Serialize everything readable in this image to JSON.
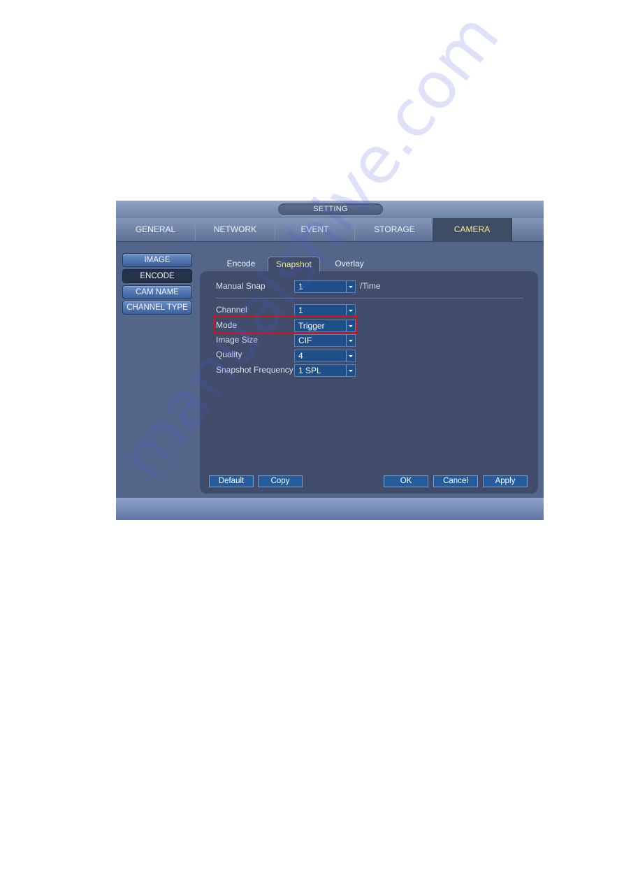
{
  "window": {
    "title": "SETTING"
  },
  "main_tabs": [
    {
      "label": "GENERAL",
      "active": false
    },
    {
      "label": "NETWORK",
      "active": false
    },
    {
      "label": "EVENT",
      "active": false
    },
    {
      "label": "STORAGE",
      "active": false
    },
    {
      "label": "CAMERA",
      "active": true
    }
  ],
  "sidebar": {
    "items": [
      {
        "label": "IMAGE",
        "active": false
      },
      {
        "label": "ENCODE",
        "active": true
      },
      {
        "label": "CAM NAME",
        "active": false
      },
      {
        "label": "CHANNEL TYPE",
        "active": false
      }
    ]
  },
  "sub_tabs": [
    {
      "label": "Encode",
      "active": false
    },
    {
      "label": "Snapshot",
      "active": true
    },
    {
      "label": "Overlay",
      "active": false
    }
  ],
  "form": {
    "manual_snap": {
      "label": "Manual Snap",
      "value": "1",
      "unit": "/Time"
    },
    "channel": {
      "label": "Channel",
      "value": "1"
    },
    "mode": {
      "label": "Mode",
      "value": "Trigger",
      "highlighted": true
    },
    "image_size": {
      "label": "Image Size",
      "value": "CIF"
    },
    "quality": {
      "label": "Quality",
      "value": "4"
    },
    "snapshot_frequency": {
      "label": "Snapshot Frequency",
      "value": "1 SPL"
    }
  },
  "buttons": {
    "default": "Default",
    "copy": "Copy",
    "ok": "OK",
    "cancel": "Cancel",
    "apply": "Apply"
  },
  "colors": {
    "active_tab_text": "#f1ee8a",
    "highlight_border": "#d3141c",
    "combo_bg": "#1f4f88"
  },
  "watermark": "manualshive.com"
}
